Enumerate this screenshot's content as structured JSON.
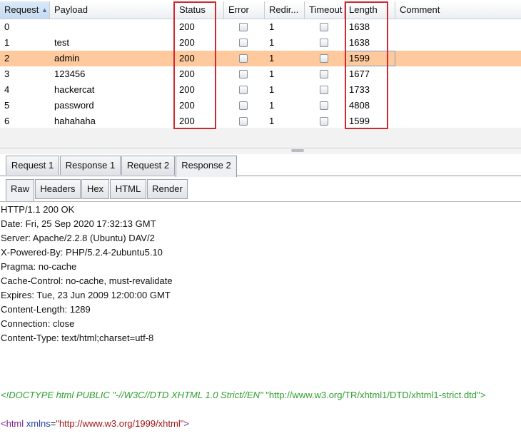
{
  "table": {
    "columns": [
      "Request",
      "Payload",
      "Status",
      "Error",
      "Redir...",
      "Timeout",
      "Length",
      "Comment"
    ],
    "sort_indicator": "▲",
    "rows": [
      {
        "request": "0",
        "payload": "",
        "status": "200",
        "error": false,
        "redirects": "1",
        "timeout": false,
        "length": "1638",
        "comment": ""
      },
      {
        "request": "1",
        "payload": "test",
        "status": "200",
        "error": false,
        "redirects": "1",
        "timeout": false,
        "length": "1638",
        "comment": ""
      },
      {
        "request": "2",
        "payload": "admin",
        "status": "200",
        "error": false,
        "redirects": "1",
        "timeout": false,
        "length": "1599",
        "comment": ""
      },
      {
        "request": "3",
        "payload": "123456",
        "status": "200",
        "error": false,
        "redirects": "1",
        "timeout": false,
        "length": "1677",
        "comment": ""
      },
      {
        "request": "4",
        "payload": "hackercat",
        "status": "200",
        "error": false,
        "redirects": "1",
        "timeout": false,
        "length": "1733",
        "comment": ""
      },
      {
        "request": "5",
        "payload": "password",
        "status": "200",
        "error": false,
        "redirects": "1",
        "timeout": false,
        "length": "4808",
        "comment": ""
      },
      {
        "request": "6",
        "payload": "hahahaha",
        "status": "200",
        "error": false,
        "redirects": "1",
        "timeout": false,
        "length": "1599",
        "comment": ""
      }
    ],
    "selected_row": 2,
    "highlight_color": "#d6262d",
    "selected_color": "#fdc99d"
  },
  "tabs": [
    "Request 1",
    "Response 1",
    "Request 2",
    "Response 2"
  ],
  "active_tab": "Response 2",
  "view_tabs": [
    "Raw",
    "Headers",
    "Hex",
    "HTML",
    "Render"
  ],
  "active_view_tab": "Raw",
  "response": {
    "headers": [
      "HTTP/1.1 200 OK",
      "Date: Fri, 25 Sep 2020 17:32:13 GMT",
      "Server: Apache/2.2.8 (Ubuntu) DAV/2",
      "X-Powered-By: PHP/5.2.4-2ubuntu5.10",
      "Pragma: no-cache",
      "Cache-Control: no-cache, must-revalidate",
      "Expires: Tue, 23 Jun 2009 12:00:00 GMT",
      "Content-Length: 1289",
      "Connection: close",
      "Content-Type: text/html;charset=utf-8"
    ],
    "doctype": {
      "open": "<!DOCTYPE html PUBLIC ",
      "public_id": "\"-//W3C//DTD XHTML 1.0 Strict//EN\"",
      "system_id": "\"http://www.w3.org/TR/xhtml1/DTD/xhtml1-strict.dtd\"",
      "close": ">"
    },
    "html_tag": {
      "open": "<",
      "name": "html",
      "attr": "xmlns",
      "eq": "=",
      "value": "\"http://www.w3.org/1999/xhtml\"",
      "close": ">"
    }
  }
}
